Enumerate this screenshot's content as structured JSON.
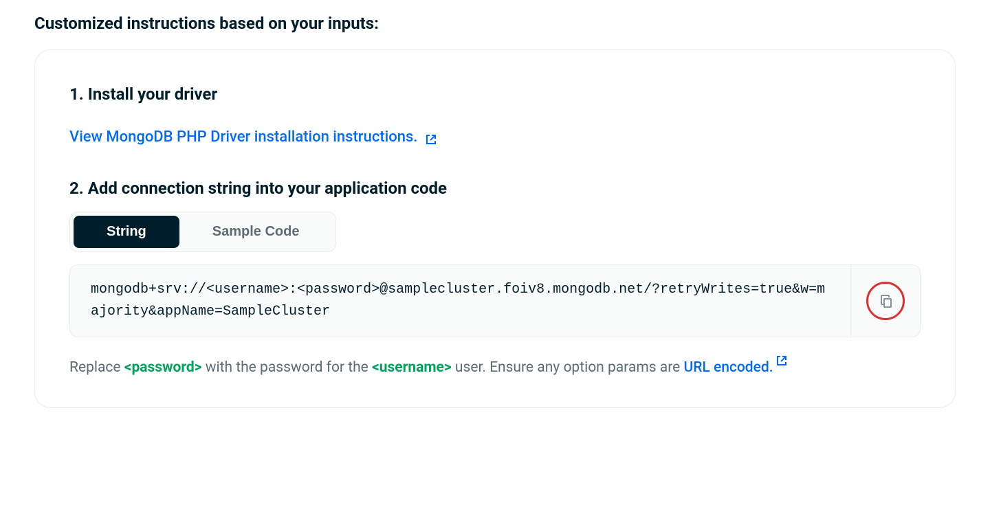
{
  "title": "Customized instructions based on your inputs:",
  "steps": {
    "step1": {
      "heading": "1. Install your driver",
      "link_text": "View MongoDB PHP Driver installation instructions."
    },
    "step2": {
      "heading": "2. Add connection string into your application code",
      "tabs": {
        "string": "String",
        "sample_code": "Sample Code"
      },
      "connection_string": "mongodb+srv://<username>:<password>@samplecluster.foiv8.mongodb.net/?retryWrites=true&w=majority&appName=SampleCluster"
    }
  },
  "note": {
    "prefix": "Replace ",
    "password_token": "<password>",
    "mid1": " with the password for the ",
    "username_token": "<username>",
    "mid2": " user. Ensure any option params are ",
    "url_encoded_link": "URL encoded."
  }
}
